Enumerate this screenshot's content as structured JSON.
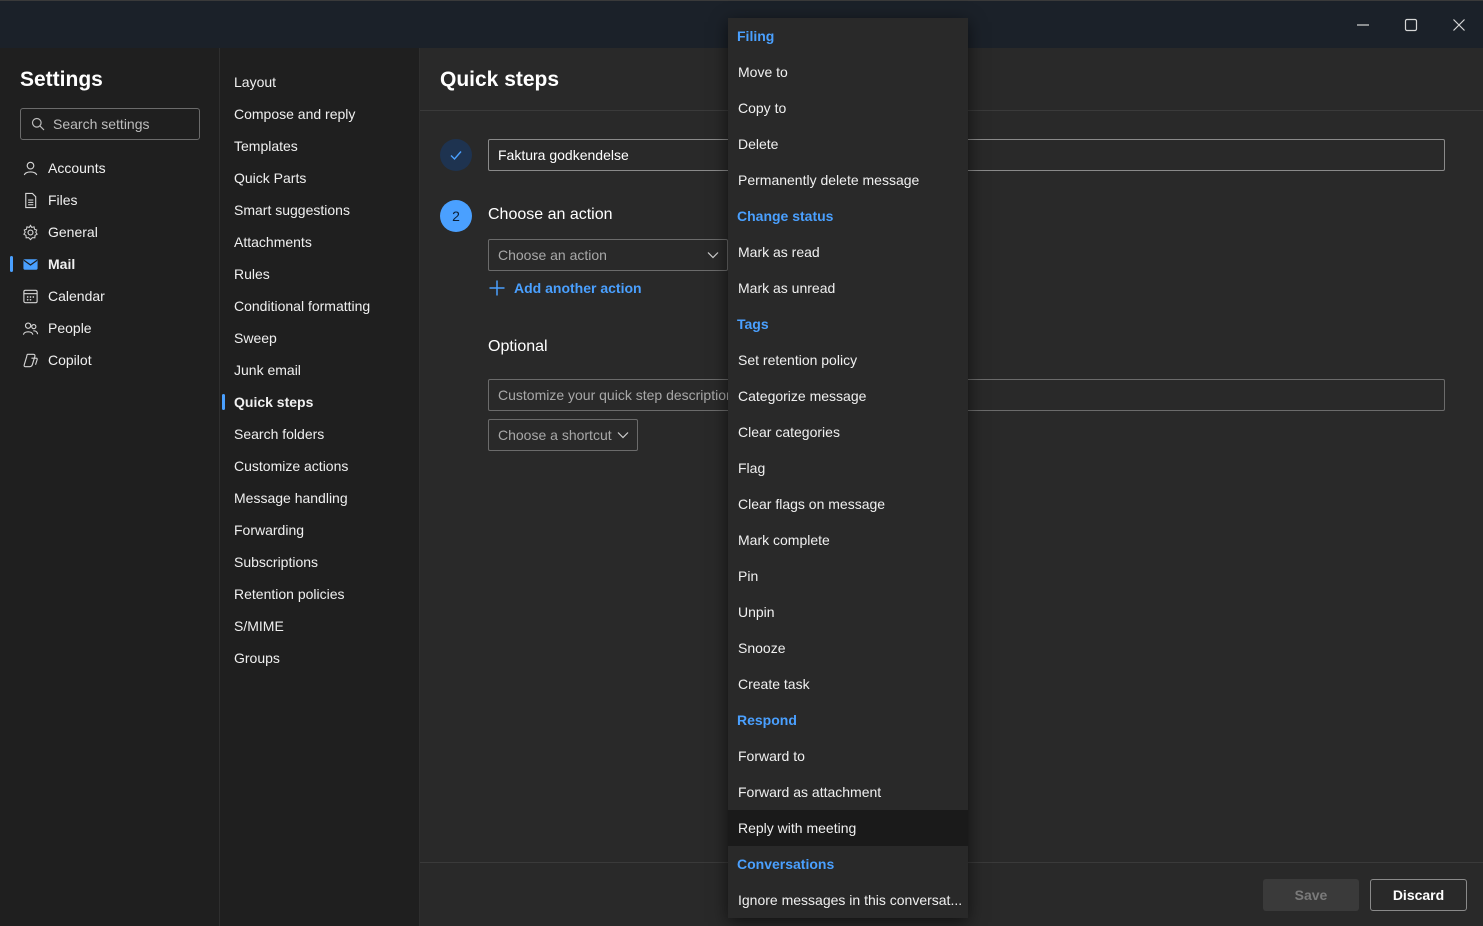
{
  "window": {
    "controls": [
      "minimize-icon",
      "maximize-icon",
      "close-icon"
    ]
  },
  "settings": {
    "title": "Settings",
    "search_placeholder": "Search settings",
    "nav": [
      {
        "label": "Accounts",
        "icon": "person-icon"
      },
      {
        "label": "Files",
        "icon": "file-icon"
      },
      {
        "label": "General",
        "icon": "gear-icon"
      },
      {
        "label": "Mail",
        "icon": "mail-icon",
        "active": true
      },
      {
        "label": "Calendar",
        "icon": "calendar-icon"
      },
      {
        "label": "People",
        "icon": "people-icon"
      },
      {
        "label": "Copilot",
        "icon": "copilot-icon"
      }
    ]
  },
  "mail_nav": [
    "Layout",
    "Compose and reply",
    "Templates",
    "Quick Parts",
    "Smart suggestions",
    "Attachments",
    "Rules",
    "Conditional formatting",
    "Sweep",
    "Junk email",
    "Quick steps",
    "Search folders",
    "Customize actions",
    "Message handling",
    "Forwarding",
    "Subscriptions",
    "Retention policies",
    "S/MIME",
    "Groups"
  ],
  "mail_nav_active": "Quick steps",
  "main": {
    "title": "Quick steps",
    "name_value": "Faktura godkendelse",
    "step_number": "2",
    "step_label": "Choose an action",
    "action_placeholder": "Choose an action",
    "add_action": "Add another action",
    "optional_label": "Optional",
    "description_placeholder": "Customize your quick step description",
    "shortcut_placeholder": "Choose a shortcut",
    "save": "Save",
    "discard": "Discard"
  },
  "menu": [
    {
      "type": "header",
      "label": "Filing"
    },
    {
      "type": "item",
      "label": "Move to"
    },
    {
      "type": "item",
      "label": "Copy to"
    },
    {
      "type": "item",
      "label": "Delete"
    },
    {
      "type": "item",
      "label": "Permanently delete message"
    },
    {
      "type": "header",
      "label": "Change status"
    },
    {
      "type": "item",
      "label": "Mark as read"
    },
    {
      "type": "item",
      "label": "Mark as unread"
    },
    {
      "type": "header",
      "label": "Tags"
    },
    {
      "type": "item",
      "label": "Set retention policy"
    },
    {
      "type": "item",
      "label": "Categorize message"
    },
    {
      "type": "item",
      "label": "Clear categories"
    },
    {
      "type": "item",
      "label": "Flag"
    },
    {
      "type": "item",
      "label": "Clear flags on message"
    },
    {
      "type": "item",
      "label": "Mark complete"
    },
    {
      "type": "item",
      "label": "Pin"
    },
    {
      "type": "item",
      "label": "Unpin"
    },
    {
      "type": "item",
      "label": "Snooze"
    },
    {
      "type": "item",
      "label": "Create task"
    },
    {
      "type": "header",
      "label": "Respond"
    },
    {
      "type": "item",
      "label": "Forward to"
    },
    {
      "type": "item",
      "label": "Forward as attachment"
    },
    {
      "type": "item",
      "label": "Reply with meeting",
      "hover": true
    },
    {
      "type": "header",
      "label": "Conversations"
    },
    {
      "type": "item",
      "label": "Ignore messages in this conversat..."
    }
  ],
  "colors": {
    "accent": "#4aa0ff",
    "titlebar": "#1b2129",
    "panel": "#1f1f1f",
    "main": "#292929"
  }
}
